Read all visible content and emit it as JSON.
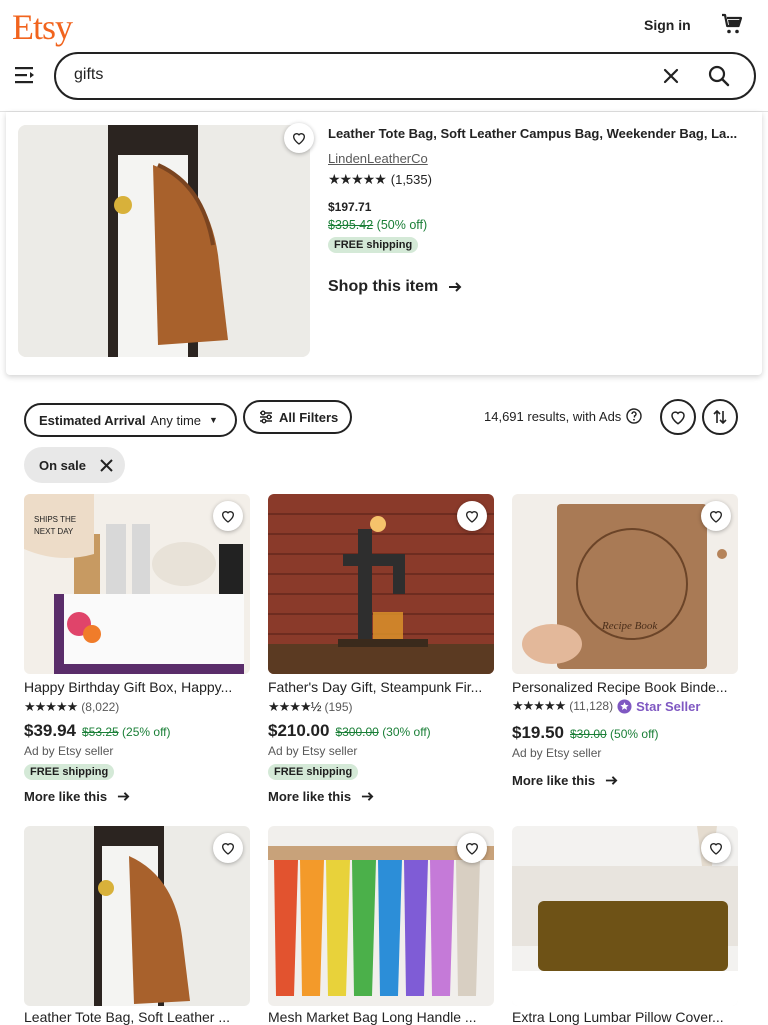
{
  "header": {
    "logo": "Etsy",
    "sign_in": "Sign in",
    "search_value": "gifts"
  },
  "featured": {
    "title": "Leather Tote Bag, Soft Leather Campus Bag, Weekender Bag, La...",
    "shop": "LindenLeatherCo",
    "rating_count": "(1,535)",
    "price": "$197.71",
    "original_price": "$395.42",
    "discount": "(50% off)",
    "shipping": "FREE shipping",
    "cta": "Shop this item"
  },
  "filters": {
    "arrival_label": "Estimated Arrival",
    "arrival_value": "Any time",
    "all_filters": "All Filters",
    "results": "14,691 results, with Ads",
    "on_sale": "On sale"
  },
  "listings": [
    {
      "title": "Happy Birthday Gift Box, Happy...",
      "rating_count": "(8,022)",
      "price": "$39.94",
      "original_price": "$53.25",
      "discount": "(25% off)",
      "ad": "Ad by Etsy seller",
      "shipping": "FREE shipping",
      "more": "More like this"
    },
    {
      "title": "Father's Day Gift, Steampunk Fir...",
      "rating_count": "(195)",
      "price": "$210.00",
      "original_price": "$300.00",
      "discount": "(30% off)",
      "ad": "Ad by Etsy seller",
      "shipping": "FREE shipping",
      "more": "More like this"
    },
    {
      "title": "Personalized Recipe Book Binde...",
      "rating_count": "(11,128)",
      "star_seller": "Star Seller",
      "price": "$19.50",
      "original_price": "$39.00",
      "discount": "(50% off)",
      "ad": "Ad by Etsy seller",
      "more": "More like this"
    },
    {
      "title": "Leather Tote Bag, Soft Leather ..."
    },
    {
      "title": "Mesh Market Bag Long Handle ..."
    },
    {
      "title": "Extra Long Lumbar Pillow Cover..."
    }
  ],
  "colors": {
    "brand": "#F1641E",
    "sale_green": "#1a7f37",
    "star_seller": "#7f58c2",
    "free_shipping_bg": "#d4e9d7"
  }
}
